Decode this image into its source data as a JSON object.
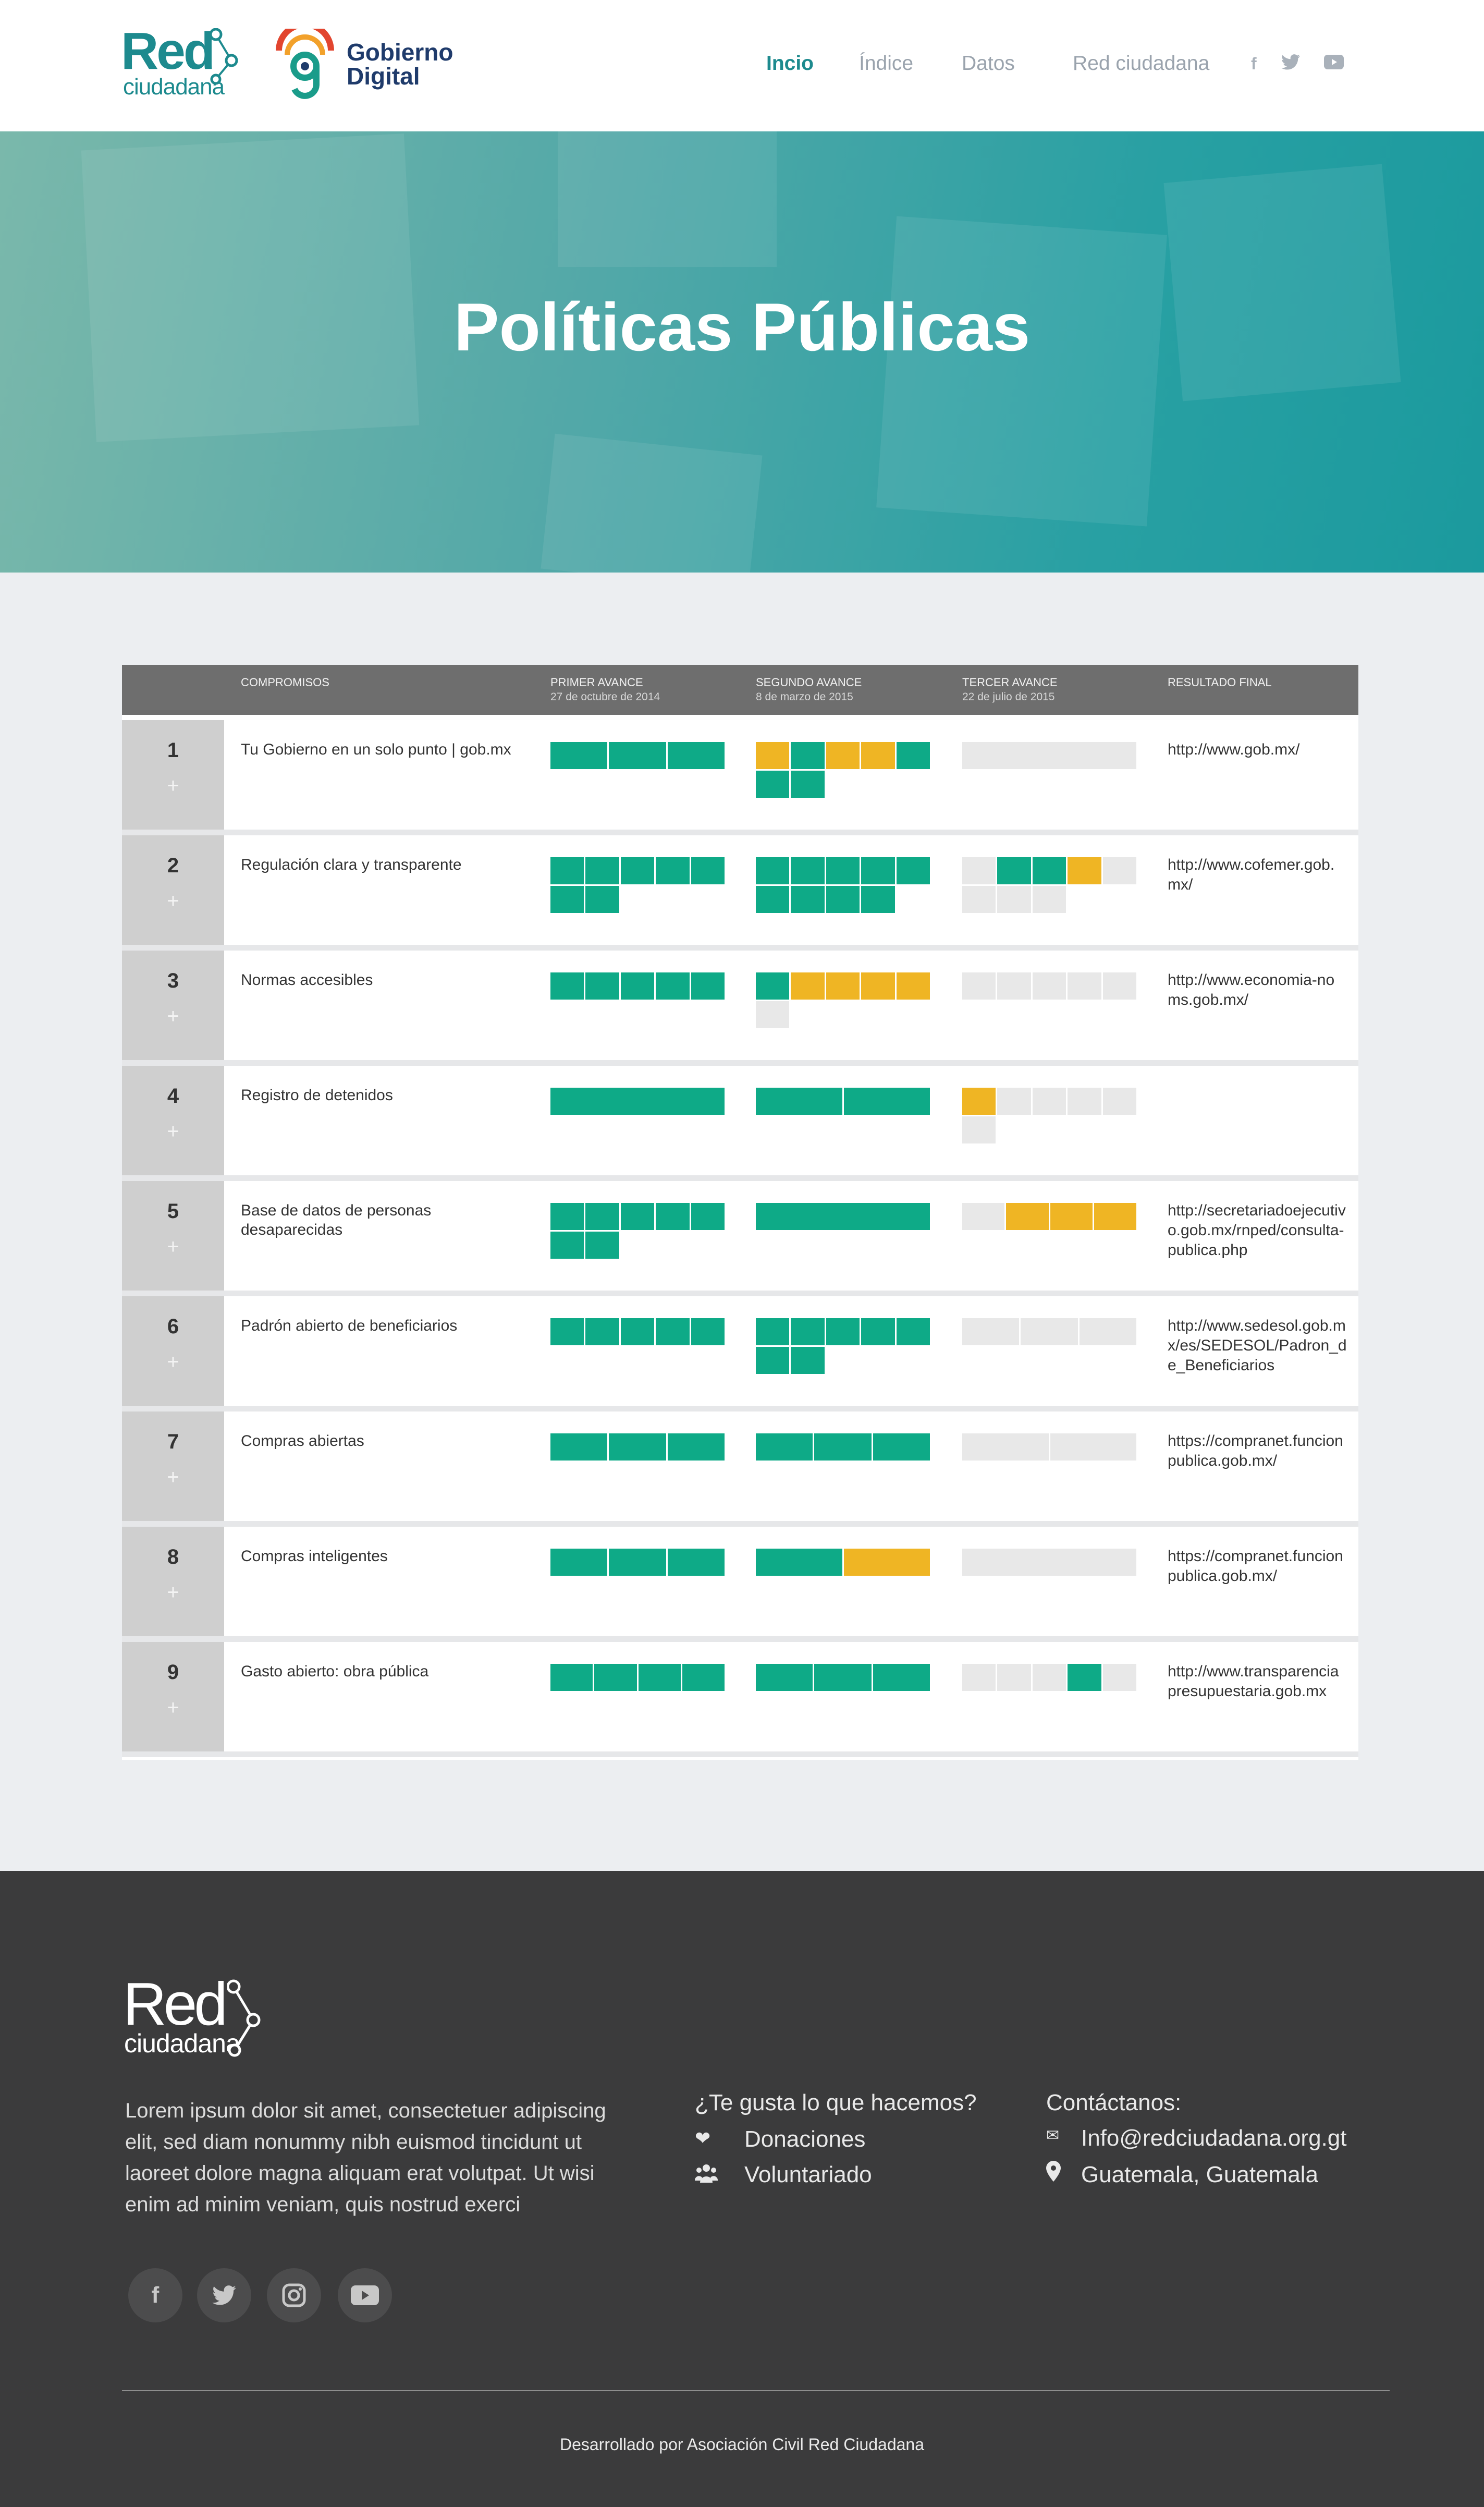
{
  "header": {
    "logo_red": "Red",
    "logo_ciudadana": "ciudadana",
    "logo_gobierno": "Gobierno",
    "logo_digital": "Digital",
    "nav": [
      "Incio",
      "Índice",
      "Datos",
      "Red ciudadana"
    ],
    "active_nav": "Incio",
    "social": [
      "facebook-icon",
      "twitter-icon",
      "youtube-icon"
    ],
    "accent_color": "#1d8a8e"
  },
  "hero": {
    "title": "Políticas Públicas"
  },
  "table": {
    "columns": {
      "compromisos": "COMPROMISOS",
      "primer": "PRIMER AVANCE",
      "primer_date": "27 de octubre de 2014",
      "segundo": "SEGUNDO AVANCE",
      "segundo_date": "8 de marzo de 2015",
      "tercer": "TERCER AVANCE",
      "tercer_date": "22 de julio de 2015",
      "resultado": "RESULTADO FINAL"
    },
    "colors": {
      "complete": "#0eaa87",
      "in_progress": "#efb524",
      "pending": "#e8e8e8"
    },
    "rows": [
      {
        "num": "1",
        "plus": "+",
        "title": "Tu Gobierno en un solo punto | gob.mx",
        "link": "http://www.gob.mx/",
        "p1": [
          "g",
          "g",
          "g"
        ],
        "p2": [
          "y",
          "g",
          "y",
          "y",
          "g",
          "g",
          "g"
        ],
        "p3": [
          "e"
        ]
      },
      {
        "num": "2",
        "plus": "+",
        "title": "Regulación clara y transparente",
        "link": "http://www.cofemer.gob.mx/",
        "p1": [
          "g",
          "g",
          "g",
          "g",
          "g",
          "g",
          "g"
        ],
        "p2": [
          "g",
          "g",
          "g",
          "g",
          "g",
          "g",
          "g",
          "g",
          "g"
        ],
        "p3": [
          "e",
          "g",
          "g",
          "y",
          "e",
          "e",
          "e",
          "e"
        ]
      },
      {
        "num": "3",
        "plus": "+",
        "title": "Normas accesibles",
        "link": "http://www.economia-noms.gob.mx/",
        "p1": [
          "g",
          "g",
          "g",
          "g",
          "g"
        ],
        "p2": [
          "g",
          "y",
          "y",
          "y",
          "y",
          "e"
        ],
        "p3": [
          "e",
          "e",
          "e",
          "e",
          "e"
        ]
      },
      {
        "num": "4",
        "plus": "+",
        "title": "Registro de detenidos",
        "link": "",
        "p1": [
          "g"
        ],
        "p2": [
          "g",
          "g"
        ],
        "p3": [
          "y",
          "e",
          "e",
          "e",
          "e",
          "e"
        ]
      },
      {
        "num": "5",
        "plus": "+",
        "title": "Base de datos de personas desaparecidas",
        "link": "http://secretariadoejecutivo.gob.mx/rnped/consulta-publica.php",
        "p1": [
          "g",
          "g",
          "g",
          "g",
          "g",
          "g",
          "g"
        ],
        "p2": [
          "g"
        ],
        "p3": [
          "e",
          "y",
          "y",
          "y"
        ]
      },
      {
        "num": "6",
        "plus": "+",
        "title": "Padrón abierto de beneficiarios",
        "link": "http://www.sedesol.gob.mx/es/SEDESOL/Padron_de_Beneficiarios",
        "p1": [
          "g",
          "g",
          "g",
          "g",
          "g"
        ],
        "p2": [
          "g",
          "g",
          "g",
          "g",
          "g",
          "g",
          "g"
        ],
        "p3": [
          "e",
          "e",
          "e"
        ]
      },
      {
        "num": "7",
        "plus": "+",
        "title": "Compras abiertas",
        "link": "https://compranet.funcionpublica.gob.mx/",
        "p1": [
          "g",
          "g",
          "g"
        ],
        "p2": [
          "g",
          "g",
          "g"
        ],
        "p3": [
          "e",
          "e"
        ]
      },
      {
        "num": "8",
        "plus": "+",
        "title": "Compras inteligentes",
        "link": "https://compranet.funcionpublica.gob.mx/",
        "p1": [
          "g",
          "g",
          "g"
        ],
        "p2": [
          "g",
          "y"
        ],
        "p3": [
          "e"
        ]
      },
      {
        "num": "9",
        "plus": "+",
        "title": "Gasto abierto: obra pública",
        "link": "http://www.transparenciapresupuestaria.gob.mx",
        "p1": [
          "g",
          "g",
          "g",
          "g"
        ],
        "p2": [
          "g",
          "g",
          "g"
        ],
        "p3": [
          "e",
          "e",
          "e",
          "g",
          "e"
        ]
      }
    ]
  },
  "footer": {
    "logo_red": "Red",
    "logo_ciudadana": "ciudadana",
    "description": "Lorem ipsum dolor sit amet, consectetuer adipiscing elit, sed diam nonummy nibh euismod tincidunt ut laoreet dolore magna aliquam erat volutpat. Ut wisi enim ad minim veniam, quis nostrud exerci",
    "social": [
      "facebook-icon",
      "twitter-icon",
      "instagram-icon",
      "youtube-icon"
    ],
    "like_heading": "¿Te gusta lo que hacemos?",
    "donaciones": "Donaciones",
    "voluntariado": "Voluntariado",
    "contact_heading": "Contáctanos:",
    "email": "Info@redciudadana.org.gt",
    "location": "Guatemala, Guatemala",
    "credit": "Desarrollado por Asociación Civil Red Ciudadana"
  }
}
